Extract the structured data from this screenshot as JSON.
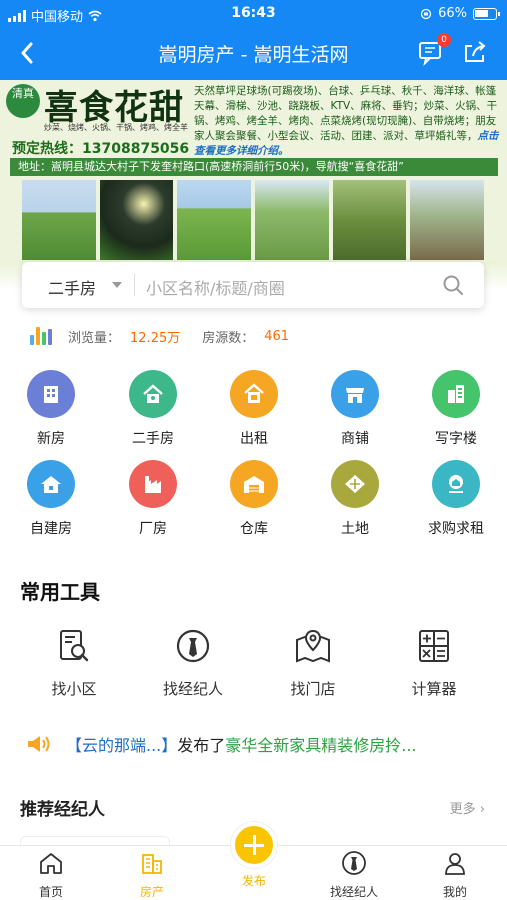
{
  "status_bar": {
    "carrier": "中国移动",
    "time": "16:43",
    "battery": "66%"
  },
  "nav": {
    "title": "嵩明房产 - 嵩明生活网",
    "message_badge": "0"
  },
  "banner": {
    "seal_text": "清真",
    "brand_name": "喜食花甜",
    "sub_names": "炒菜、烧烤、火锅、干锅、烤鸡、烤全羊",
    "description": "天然草坪足球场(可踢夜场)、台球、乒乓球、秋千、海洋球、帐篷天幕、滑梯、沙池、跷跷板、KTV、麻将、垂钓；炒菜、火锅、干锅、烤鸡、烤全羊、烤肉、点菜烧烤(现切现腌)、自带烧烤；朋友家人聚会聚餐、小型会议、活动、团建、派对、草坪婚礼等，",
    "cta": "点击查看更多详细介绍。",
    "hotline": "预定热线：13708875056",
    "address": "地址：嵩明县城达大村子下发奎村路口(高速桥洞前行50米)，导航搜“喜食花甜”"
  },
  "search": {
    "type": "二手房",
    "placeholder": "小区名称/标题/商圈"
  },
  "stats": {
    "views_label": "浏览量：",
    "views_value": "12.25万",
    "listings_label": "房源数：",
    "listings_value": "461"
  },
  "categories": [
    {
      "label": "新房",
      "color": "#6b7fd7",
      "icon": "building-icon"
    },
    {
      "label": "二手房",
      "color": "#3db88b",
      "icon": "house-icon"
    },
    {
      "label": "出租",
      "color": "#f5a623",
      "icon": "rent-icon"
    },
    {
      "label": "商铺",
      "color": "#3aa0e8",
      "icon": "shop-icon"
    },
    {
      "label": "写字楼",
      "color": "#46c46b",
      "icon": "office-icon"
    },
    {
      "label": "自建房",
      "color": "#3aa0e8",
      "icon": "self-built-house-icon"
    },
    {
      "label": "厂房",
      "color": "#f0605a",
      "icon": "factory-icon"
    },
    {
      "label": "仓库",
      "color": "#f5a623",
      "icon": "warehouse-icon"
    },
    {
      "label": "土地",
      "color": "#a8a83c",
      "icon": "land-icon"
    },
    {
      "label": "求购求租",
      "color": "#3ab6c4",
      "icon": "request-icon"
    }
  ],
  "tools": {
    "title": "常用工具",
    "items": [
      {
        "label": "找小区",
        "icon": "community-search-icon"
      },
      {
        "label": "找经纪人",
        "icon": "agent-icon"
      },
      {
        "label": "找门店",
        "icon": "store-map-icon"
      },
      {
        "label": "计算器",
        "icon": "calculator-icon"
      }
    ]
  },
  "ticker": {
    "user": "【云的那端...】",
    "action": "发布了",
    "item": "豪华全新家具精装修房拎..."
  },
  "agents": {
    "title": "推荐经纪人",
    "more": "更多"
  },
  "tabbar": {
    "items": [
      {
        "label": "首页",
        "icon": "home-icon"
      },
      {
        "label": "房产",
        "icon": "property-icon",
        "active": true
      },
      {
        "label": "发布",
        "icon": "publish-plus-icon"
      },
      {
        "label": "找经纪人",
        "icon": "agent-icon"
      },
      {
        "label": "我的",
        "icon": "profile-icon"
      }
    ]
  },
  "colors": {
    "primary": "#1588f5",
    "accent": "#f7b500",
    "highlight": "#ff6a00"
  }
}
